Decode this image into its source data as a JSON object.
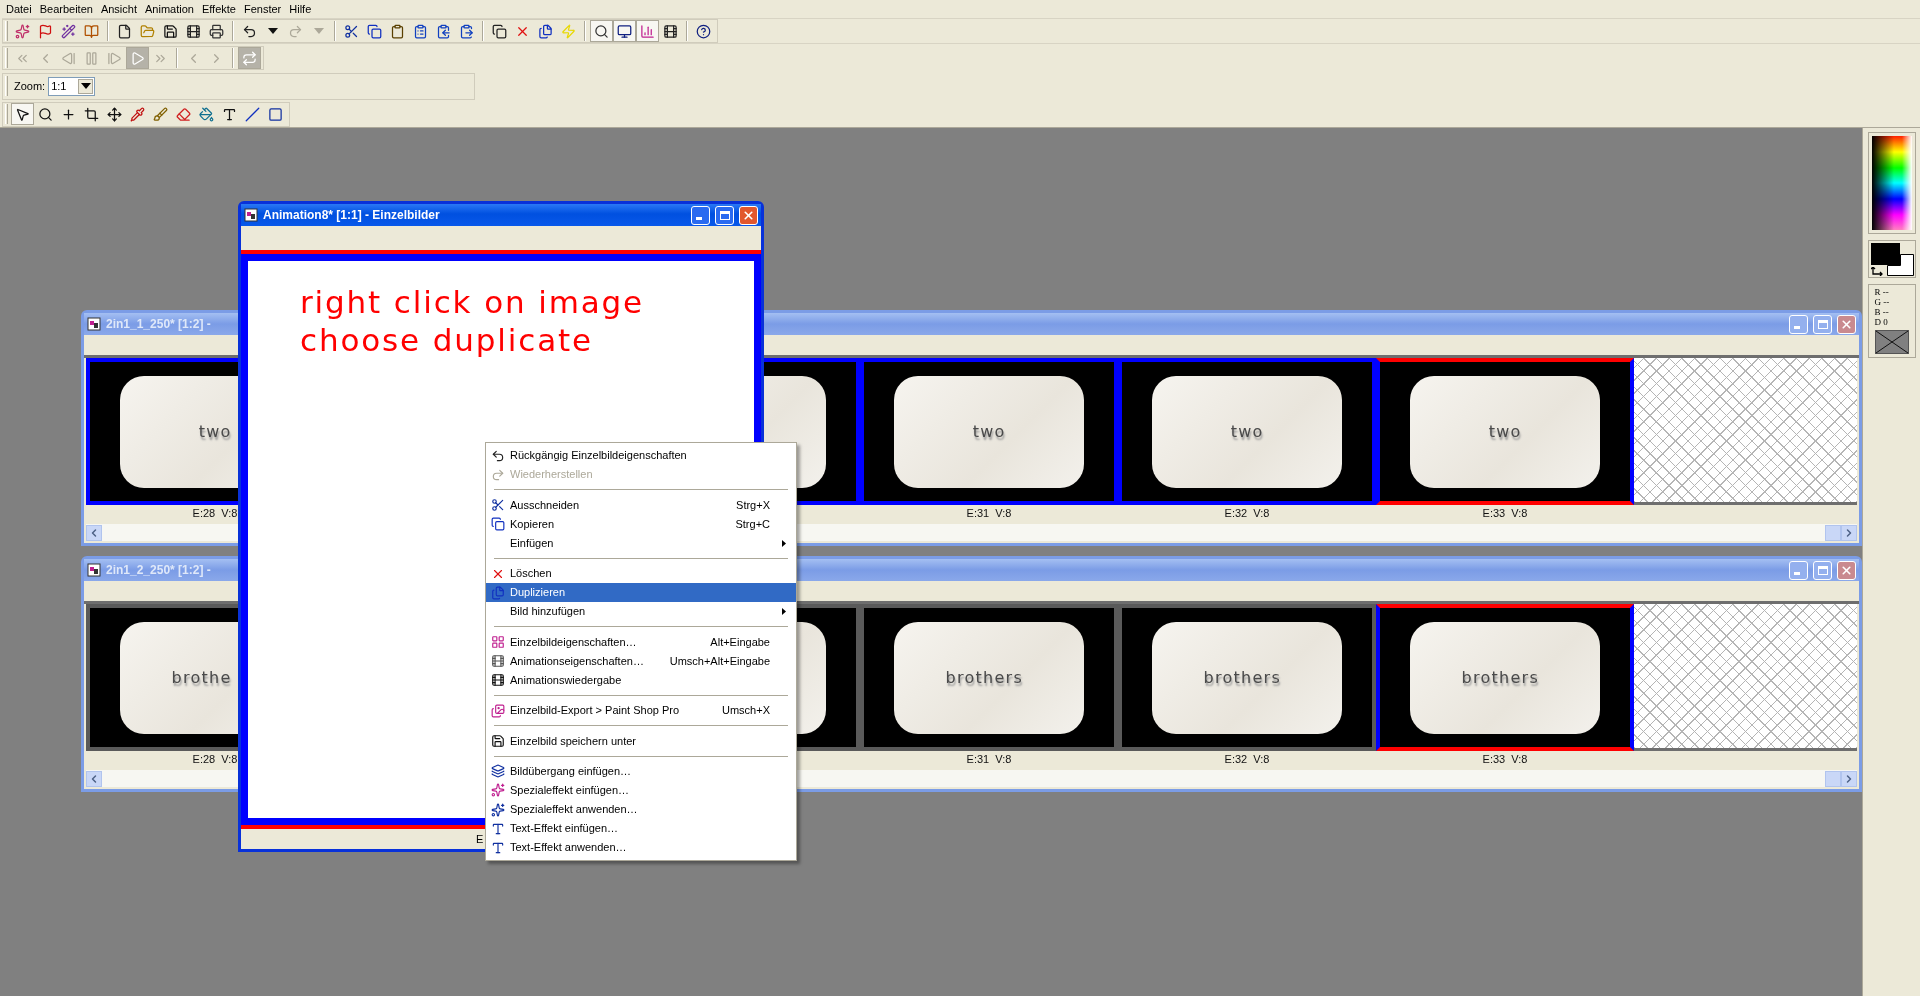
{
  "menu_bar": [
    "Datei",
    "Bearbeiten",
    "Ansicht",
    "Animation",
    "Effekte",
    "Fenster",
    "Hilfe"
  ],
  "main_toolbar": [
    [
      {
        "pressed": false,
        "disabled": false
      },
      {
        "pressed": false,
        "disabled": false
      },
      {
        "pressed": false,
        "disabled": false
      },
      {
        "pressed": false,
        "disabled": false
      }
    ],
    [
      {
        "pressed": false,
        "disabled": false
      },
      {
        "pressed": false,
        "disabled": false
      },
      {
        "pressed": false,
        "disabled": false
      },
      {
        "pressed": false,
        "disabled": false
      },
      {
        "pressed": false,
        "disabled": false
      }
    ],
    [
      {
        "pressed": false,
        "disabled": false
      },
      {
        "pressed": false,
        "disabled": false
      },
      {
        "pressed": false,
        "disabled": true
      },
      {
        "pressed": false,
        "disabled": true
      }
    ],
    [
      {
        "pressed": false,
        "disabled": false
      },
      {
        "pressed": false,
        "disabled": false
      },
      {
        "pressed": false,
        "disabled": false
      },
      {
        "pressed": false,
        "disabled": false
      },
      {
        "pressed": false,
        "disabled": false
      },
      {
        "pressed": false,
        "disabled": false
      }
    ],
    [
      {
        "pressed": false,
        "disabled": false
      },
      {
        "pressed": false,
        "disabled": false
      },
      {
        "pressed": false,
        "disabled": false
      },
      {
        "pressed": false,
        "disabled": false
      }
    ],
    [
      {
        "pressed": true,
        "disabled": false
      },
      {
        "pressed": true,
        "disabled": false
      },
      {
        "pressed": true,
        "disabled": false
      },
      {
        "pressed": false,
        "disabled": false
      }
    ],
    [
      {
        "pressed": false,
        "disabled": false
      }
    ]
  ],
  "playback_toolbar": [
    [
      {
        "pressed": false,
        "disabled": true
      },
      {
        "pressed": false,
        "disabled": true
      },
      {
        "pressed": false,
        "disabled": true
      },
      {
        "pressed": false,
        "disabled": true
      },
      {
        "pressed": false,
        "disabled": true
      },
      {
        "pressed": true,
        "disabled": true
      },
      {
        "pressed": false,
        "disabled": true
      }
    ],
    [
      {
        "pressed": false,
        "disabled": true
      },
      {
        "pressed": false,
        "disabled": true
      }
    ],
    [
      {
        "pressed": true,
        "disabled": true
      }
    ]
  ],
  "zoom": {
    "label": "Zoom:",
    "value": "1:1"
  },
  "tools": [
    {
      "selected": true
    },
    {
      "selected": false
    },
    {
      "selected": false
    },
    {
      "selected": false
    },
    {
      "selected": false
    },
    {
      "selected": false
    },
    {
      "selected": false
    },
    {
      "selected": false
    },
    {
      "selected": false
    },
    {
      "selected": false
    },
    {
      "selected": false
    },
    {
      "selected": false
    }
  ],
  "sequence_windows": [
    {
      "title": "2in1_1_250* [1:2] -",
      "active": false,
      "frames": [
        {
          "caption": "two",
          "label": "E:28  V:8",
          "selected": true,
          "current": false
        },
        {
          "selected": true,
          "current": false
        },
        {
          "caption": "two",
          "label": "E:31  V:8",
          "selected": true,
          "current": false
        },
        {
          "caption": "two",
          "label": "E:32  V:8",
          "selected": true,
          "current": false
        },
        {
          "caption": "two",
          "label": "E:33  V:8",
          "selected": true,
          "current": true
        }
      ]
    },
    {
      "title": "2in1_2_250* [1:2] -",
      "active": false,
      "frames": [
        {
          "caption": "brothe",
          "label": "E:28  V:8",
          "selected": false,
          "current": false
        },
        {
          "selected": false,
          "current": false
        },
        {
          "caption": "brothers",
          "label": "E:31  V:8",
          "selected": false,
          "current": false
        },
        {
          "caption": "brothers",
          "label": "E:32  V:8",
          "selected": false,
          "current": false
        },
        {
          "caption": "brothers",
          "label": "E:33  V:8",
          "selected": true,
          "current": true
        }
      ]
    }
  ],
  "frame_editor": {
    "title": "Animation8* [1:1] - Einzelbilder",
    "active": true,
    "lines": [
      "right click on image",
      "choose duplicate"
    ],
    "frame_label": "E"
  },
  "context_menu": [
    {
      "kind": "item",
      "label": "Rückgängig Einzelbildeigenschaften",
      "selected": false,
      "disabled": false,
      "submenu": false
    },
    {
      "kind": "item",
      "label": "Wiederherstellen",
      "selected": false,
      "disabled": true,
      "submenu": false
    },
    {
      "kind": "separator"
    },
    {
      "kind": "item",
      "label": "Ausschneiden",
      "shortcut": "Strg+X",
      "selected": false,
      "disabled": false,
      "submenu": false
    },
    {
      "kind": "item",
      "label": "Kopieren",
      "shortcut": "Strg+C",
      "selected": false,
      "disabled": false,
      "submenu": false
    },
    {
      "kind": "item",
      "label": "Einfügen",
      "selected": false,
      "disabled": false,
      "submenu": true
    },
    {
      "kind": "separator"
    },
    {
      "kind": "item",
      "label": "Löschen",
      "selected": false,
      "disabled": false,
      "submenu": false
    },
    {
      "kind": "item",
      "label": "Duplizieren",
      "selected": true,
      "disabled": false,
      "submenu": false
    },
    {
      "kind": "item",
      "label": "Bild hinzufügen",
      "selected": false,
      "disabled": false,
      "submenu": true
    },
    {
      "kind": "separator"
    },
    {
      "kind": "item",
      "label": "Einzelbildeigenschaften…",
      "shortcut": "Alt+Eingabe",
      "selected": false,
      "disabled": false,
      "submenu": false
    },
    {
      "kind": "item",
      "label": "Animationseigenschaften…",
      "shortcut": "Umsch+Alt+Eingabe",
      "selected": false,
      "disabled": false,
      "submenu": false
    },
    {
      "kind": "item",
      "label": "Animationswiedergabe",
      "selected": false,
      "disabled": false,
      "submenu": false
    },
    {
      "kind": "separator"
    },
    {
      "kind": "item",
      "label": "Einzelbild-Export > Paint Shop Pro",
      "shortcut": "Umsch+X",
      "selected": false,
      "disabled": false,
      "submenu": false
    },
    {
      "kind": "separator"
    },
    {
      "kind": "item",
      "label": "Einzelbild speichern unter",
      "selected": false,
      "disabled": false,
      "submenu": false
    },
    {
      "kind": "separator"
    },
    {
      "kind": "item",
      "label": "Bildübergang einfügen…",
      "selected": false,
      "disabled": false,
      "submenu": false
    },
    {
      "kind": "item",
      "label": "Spezialeffekt einfügen…",
      "selected": false,
      "disabled": false,
      "submenu": false
    },
    {
      "kind": "item",
      "label": "Spezialeffekt anwenden…",
      "selected": false,
      "disabled": false,
      "submenu": false
    },
    {
      "kind": "item",
      "label": "Text-Effekt einfügen…",
      "selected": false,
      "disabled": false,
      "submenu": false
    },
    {
      "kind": "item",
      "label": "Text-Effekt anwenden…",
      "selected": false,
      "disabled": false,
      "submenu": false
    }
  ],
  "color_palette": {
    "readouts": [
      "R --",
      "G --",
      "B --",
      "D 0"
    ]
  }
}
